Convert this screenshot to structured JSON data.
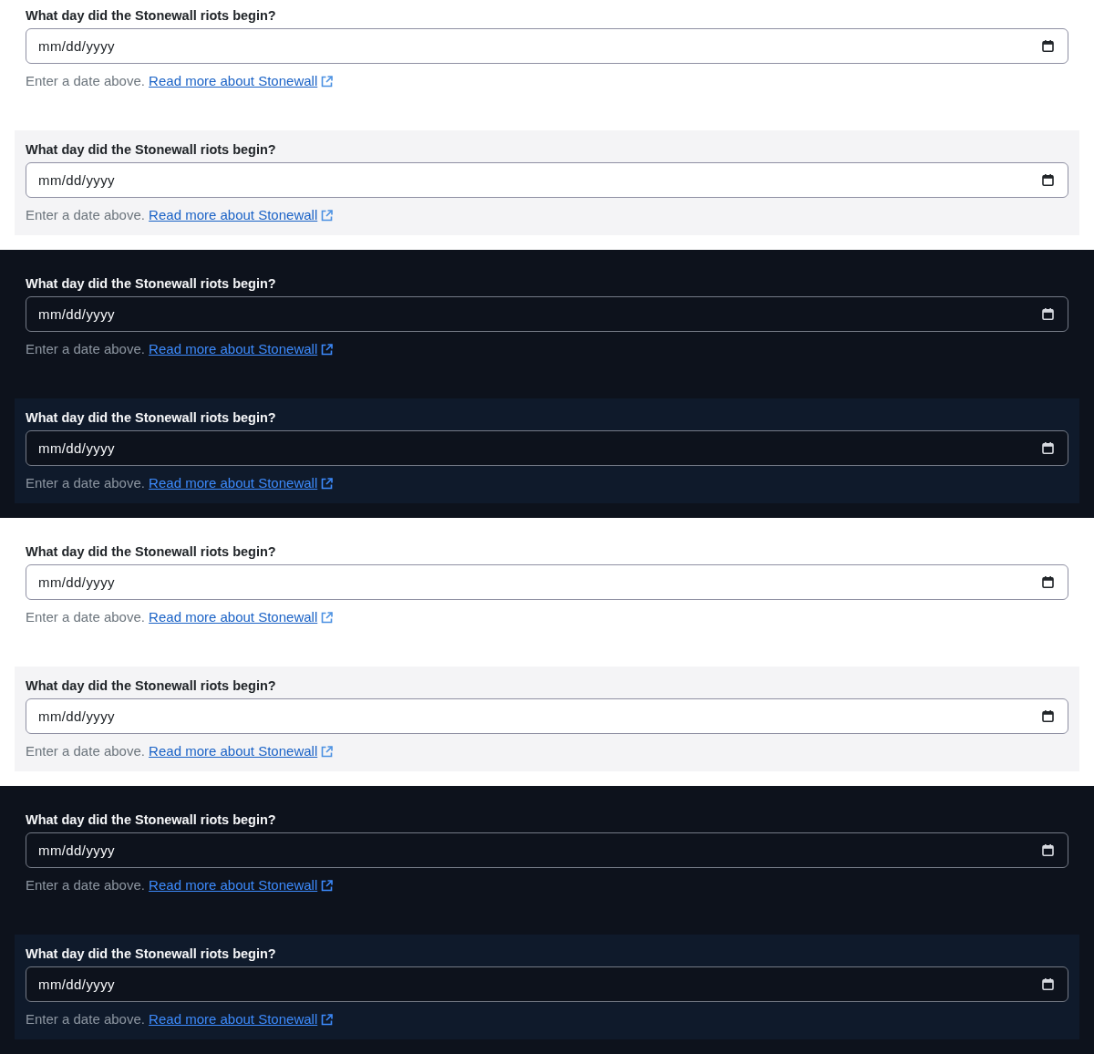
{
  "sections": [
    {
      "dark": false,
      "questions": [
        {
          "kind": "plain",
          "label": "What day did the Stonewall riots begin?",
          "placeholder": "mm/dd/yyyy",
          "help": "Enter a date above.",
          "link": "Read more about Stonewall"
        },
        {
          "kind": "panel",
          "label": "What day did the Stonewall riots begin?",
          "placeholder": "mm/dd/yyyy",
          "help": "Enter a date above.",
          "link": "Read more about Stonewall"
        }
      ]
    },
    {
      "dark": true,
      "questions": [
        {
          "kind": "plain",
          "label": "What day did the Stonewall riots begin?",
          "placeholder": "mm/dd/yyyy",
          "help": "Enter a date above.",
          "link": "Read more about Stonewall"
        },
        {
          "kind": "panel",
          "label": "What day did the Stonewall riots begin?",
          "placeholder": "mm/dd/yyyy",
          "help": "Enter a date above.",
          "link": "Read more about Stonewall"
        }
      ]
    },
    {
      "dark": false,
      "questions": [
        {
          "kind": "plain",
          "label": "What day did the Stonewall riots begin?",
          "placeholder": "mm/dd/yyyy",
          "help": "Enter a date above.",
          "link": "Read more about Stonewall"
        },
        {
          "kind": "panel",
          "label": "What day did the Stonewall riots begin?",
          "placeholder": "mm/dd/yyyy",
          "help": "Enter a date above.",
          "link": "Read more about Stonewall"
        }
      ]
    },
    {
      "dark": true,
      "questions": [
        {
          "kind": "plain",
          "label": "What day did the Stonewall riots begin?",
          "placeholder": "mm/dd/yyyy",
          "help": "Enter a date above.",
          "link": "Read more about Stonewall"
        },
        {
          "kind": "panel",
          "label": "What day did the Stonewall riots begin?",
          "placeholder": "mm/dd/yyyy",
          "help": "Enter a date above.",
          "link": "Read more about Stonewall"
        }
      ]
    }
  ]
}
